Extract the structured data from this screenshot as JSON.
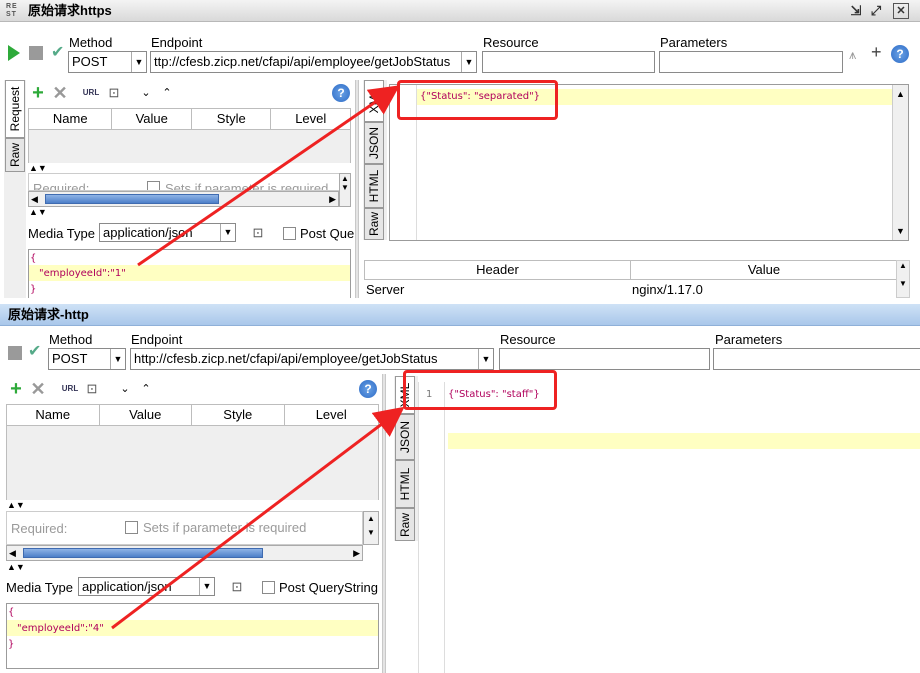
{
  "top": {
    "title": "原始请求https",
    "title_icon": "rest-icon",
    "labels": {
      "method": "Method",
      "endpoint": "Endpoint",
      "resource": "Resource",
      "parameters": "Parameters"
    },
    "method_value": "POST",
    "endpoint_value": "ttp://cfesb.zicp.net/cfapi/api/employee/getJobStatus",
    "resource_value": "",
    "parameters_value": "",
    "request_tabs": [
      "Request",
      "Raw"
    ],
    "grid_columns": [
      "Name",
      "Value",
      "Style",
      "Level"
    ],
    "required_label": "Required:",
    "required_hint": "Sets if parameter is required",
    "media_type_label": "Media Type",
    "media_type_value": "application/json",
    "post_query_label": "Post Que",
    "request_body": {
      "open": "{",
      "line": "\"employeeId\":\"1\"",
      "close": "}"
    },
    "response_tabs": [
      "XML",
      "JSON",
      "HTML",
      "Raw"
    ],
    "response_text": "{\"Status\": \"separated\"}",
    "headers_columns": [
      "Header",
      "Value"
    ],
    "headers_rows": [
      {
        "header": "Server",
        "value": "nginx/1.17.0"
      }
    ]
  },
  "bottom": {
    "title": "原始请求-http",
    "labels": {
      "method": "Method",
      "endpoint": "Endpoint",
      "resource": "Resource",
      "parameters": "Parameters"
    },
    "method_value": "POST",
    "endpoint_value": "http://cfesb.zicp.net/cfapi/api/employee/getJobStatus",
    "resource_value": "",
    "parameters_value": "",
    "grid_columns": [
      "Name",
      "Value",
      "Style",
      "Level"
    ],
    "required_label": "Required:",
    "required_hint": "Sets if parameter is required",
    "media_type_label": "Media Type",
    "media_type_value": "application/json",
    "post_query_label": "Post QueryString",
    "request_body": {
      "open": "{",
      "line": "\"employeeId\":\"4\"",
      "close": "}"
    },
    "response_tabs": [
      "XML",
      "JSON",
      "HTML",
      "Raw"
    ],
    "line_number": "1",
    "response_text": "{\"Status\": \"staff\"}"
  },
  "colors": {
    "annotation": "#ee2222",
    "highlight": "#ffffc2",
    "json_text": "#b0005c",
    "play": "#2eaa3a"
  }
}
